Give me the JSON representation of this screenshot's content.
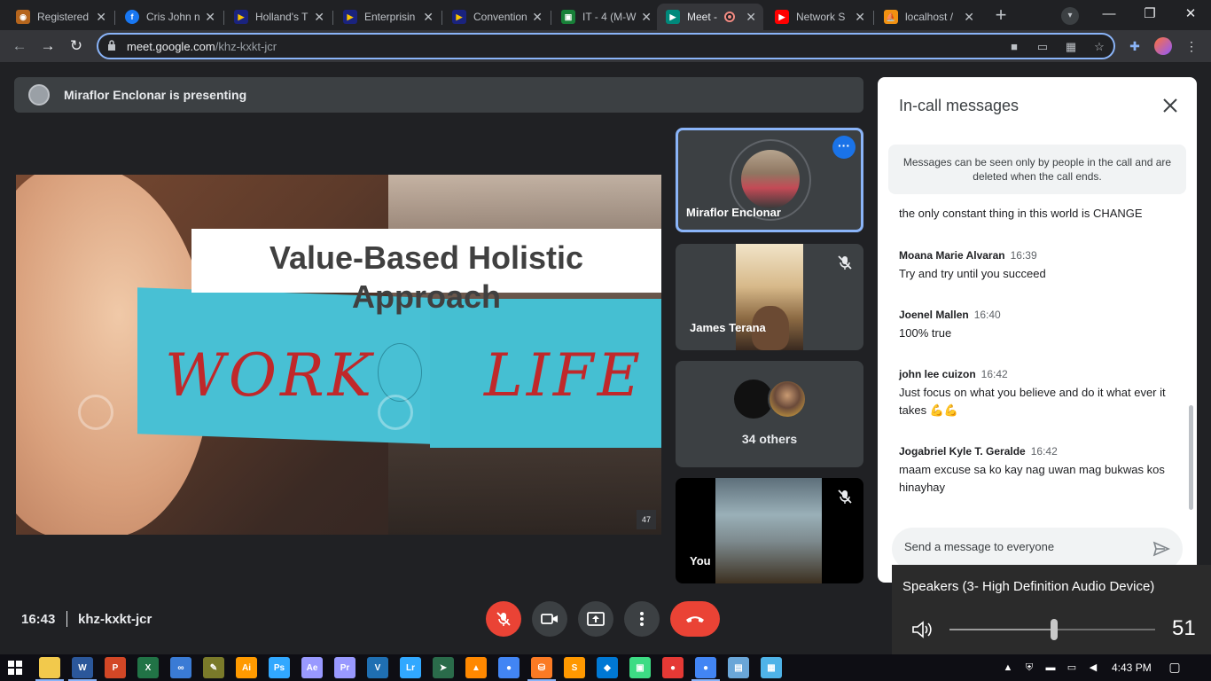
{
  "browser": {
    "tabs": [
      {
        "title": "Registered",
        "favicon": "seal-icon",
        "color": "#b5651d",
        "active": false
      },
      {
        "title": "Cris John n",
        "favicon": "facebook-icon",
        "color": "#1877f2",
        "active": false
      },
      {
        "title": "Holland's T",
        "favicon": "play-icon",
        "color": "#1a237e",
        "active": false
      },
      {
        "title": "Enterprisin",
        "favicon": "play-icon",
        "color": "#1a237e",
        "active": false
      },
      {
        "title": "Convention",
        "favicon": "play-icon",
        "color": "#1a237e",
        "active": false
      },
      {
        "title": "IT - 4 (M-W",
        "favicon": "classroom-icon",
        "color": "#188038",
        "active": false
      },
      {
        "title": "Meet - ",
        "favicon": "meet-icon",
        "color": "#00897b",
        "active": true
      },
      {
        "title": "Network S",
        "favicon": "youtube-icon",
        "color": "#ff0000",
        "active": false
      },
      {
        "title": "localhost /",
        "favicon": "phpmyadmin-icon",
        "color": "#f29111",
        "active": false
      }
    ],
    "url_host": "meet.google.com",
    "url_path": "/khz-kxkt-jcr"
  },
  "meet": {
    "presenting_text": "Miraflor Enclonar is presenting",
    "slide": {
      "title": "Value-Based Holistic Approach",
      "word_left": "WORK",
      "word_right": "LIFE",
      "page_number": "47"
    },
    "tiles": {
      "presenter_name": "Miraflor Enclonar",
      "participant_name": "James Terana",
      "others_label": "34 others",
      "self_label": "You"
    },
    "time": "16:43",
    "meeting_code": "khz-kxkt-jcr",
    "accent_color": "#ea4335"
  },
  "chat": {
    "title": "In-call messages",
    "notice": "Messages can be seen only by people in the call and are deleted when the call ends.",
    "partial_message": "the only constant thing in this world is CHANGE",
    "messages": [
      {
        "sender": "Moana Marie Alvaran",
        "time": "16:39",
        "text": "Try and try until you succeed"
      },
      {
        "sender": "Joenel Mallen",
        "time": "16:40",
        "text": "100% true"
      },
      {
        "sender": "john lee cuizon",
        "time": "16:42",
        "text": "Just focus on what you believe and do it what ever it takes 💪💪"
      },
      {
        "sender": "Jogabriel Kyle T. Geralde",
        "time": "16:42",
        "text": "maam excuse sa ko kay nag uwan mag bukwas kos hinayhay"
      }
    ],
    "input_placeholder": "Send a message to everyone"
  },
  "volume": {
    "device": "Speakers (3- High Definition Audio Device)",
    "level": "51",
    "level_fraction": 0.51
  },
  "taskbar": {
    "time": "4:43 PM",
    "apps": [
      {
        "name": "file-explorer-icon",
        "label": "",
        "color": "#f2c94c"
      },
      {
        "name": "word-icon",
        "label": "W",
        "color": "#2b579a"
      },
      {
        "name": "powerpoint-icon",
        "label": "P",
        "color": "#d24726"
      },
      {
        "name": "excel-icon",
        "label": "X",
        "color": "#217346"
      },
      {
        "name": "infinity-icon",
        "label": "∞",
        "color": "#3a7bd5"
      },
      {
        "name": "paint-icon",
        "label": "✎",
        "color": "#7a7a2a"
      },
      {
        "name": "illustrator-icon",
        "label": "Ai",
        "color": "#ff9a00"
      },
      {
        "name": "photoshop-icon",
        "label": "Ps",
        "color": "#31a8ff"
      },
      {
        "name": "after-effects-icon",
        "label": "Ae",
        "color": "#9999ff"
      },
      {
        "name": "premiere-icon",
        "label": "Pr",
        "color": "#9999ff"
      },
      {
        "name": "vegas-icon",
        "label": "V",
        "color": "#1f6fb2"
      },
      {
        "name": "lightroom-icon",
        "label": "Lr",
        "color": "#31a8ff"
      },
      {
        "name": "arrow-app-icon",
        "label": "➤",
        "color": "#2a6b4a"
      },
      {
        "name": "vlc-icon",
        "label": "▲",
        "color": "#ff8800"
      },
      {
        "name": "chrome-icon",
        "label": "●",
        "color": "#4285f4"
      },
      {
        "name": "xampp-icon",
        "label": "⛁",
        "color": "#fb7a24"
      },
      {
        "name": "sublime-icon",
        "label": "S",
        "color": "#ff9800"
      },
      {
        "name": "vscode-icon",
        "label": "◆",
        "color": "#0078d4"
      },
      {
        "name": "android-icon",
        "label": "▣",
        "color": "#3ddc84"
      },
      {
        "name": "record-icon",
        "label": "●",
        "color": "#e53935"
      },
      {
        "name": "chrome-active-icon",
        "label": "●",
        "color": "#4285f4"
      },
      {
        "name": "notepad-icon",
        "label": "▤",
        "color": "#6aa6d8"
      },
      {
        "name": "photos-icon",
        "label": "▦",
        "color": "#4fb3e8"
      }
    ]
  }
}
